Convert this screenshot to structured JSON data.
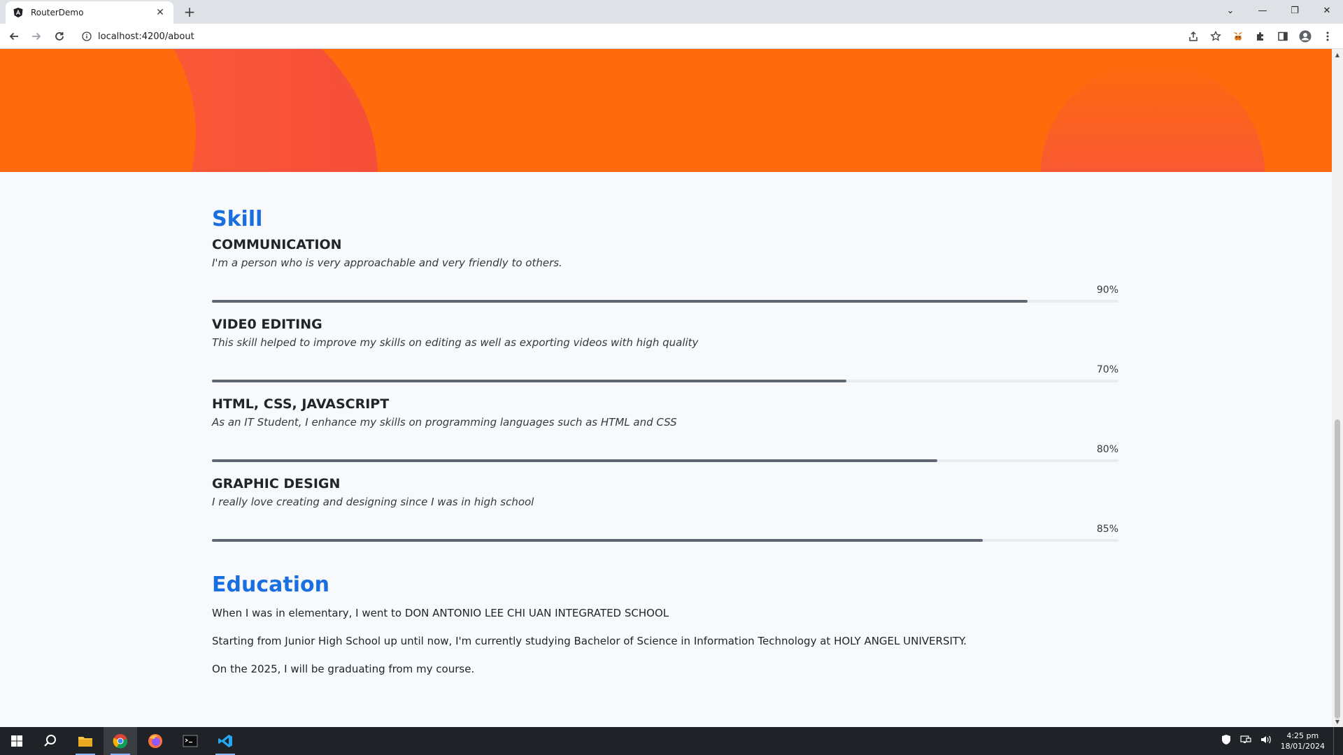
{
  "browser": {
    "tab_title": "RouterDemo",
    "url": "localhost:4200/about",
    "new_tab_label": "+"
  },
  "skills": {
    "title": "Skill",
    "items": [
      {
        "name": "COMMUNICATION",
        "desc": "I'm a person who is very approachable and very friendly to others.",
        "percent_label": "90%",
        "percent": 90
      },
      {
        "name": "VIDE0 EDITING",
        "desc": "This skill helped to improve my skills on editing as well as exporting videos with high quality",
        "percent_label": "70%",
        "percent": 70
      },
      {
        "name": "HTML, CSS, JAVASCRIPT",
        "desc": "As an IT Student, I enhance my skills on programming languages such as HTML and CSS",
        "percent_label": "80%",
        "percent": 80
      },
      {
        "name": "GRAPHIC DESIGN",
        "desc": "I really love creating and designing since I was in high school",
        "percent_label": "85%",
        "percent": 85
      }
    ]
  },
  "education": {
    "title": "Education",
    "lines": [
      "When I was in elementary, I went to DON ANTONIO LEE CHI UAN INTEGRATED SCHOOL",
      "Starting from Junior High School up until now, I'm currently studying Bachelor of Science in Information Technology at HOLY ANGEL UNIVERSITY.",
      "On the 2025, I will be graduating from my course."
    ]
  },
  "taskbar": {
    "time": "4:25 pm",
    "date": "18/01/2024"
  },
  "colors": {
    "hero": "#ff6a0d",
    "heading": "#1a6fe0",
    "bar_fill": "#5f6872"
  }
}
